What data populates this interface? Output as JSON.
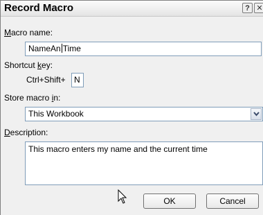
{
  "dialog": {
    "title": "Record Macro",
    "help_glyph": "?",
    "close_glyph": "✕"
  },
  "macro_name": {
    "label_prefix": "",
    "label_underlined": "M",
    "label_rest": "acro name:",
    "value_before_caret": "NameAn",
    "value_after_caret": "Time"
  },
  "shortcut": {
    "label_prefix": "Shortcut ",
    "label_underlined": "k",
    "label_rest": "ey:",
    "prefix_text": "Ctrl+Shift+",
    "key_value": "N"
  },
  "store": {
    "label_prefix": "Store macro ",
    "label_underlined": "i",
    "label_rest": "n:",
    "selected": "This Workbook",
    "arrow_icon": "chevron-down-icon"
  },
  "description": {
    "label_prefix": "",
    "label_underlined": "D",
    "label_rest": "escription:",
    "value": "This macro enters my name and the current time"
  },
  "buttons": {
    "ok": "OK",
    "cancel": "Cancel"
  }
}
